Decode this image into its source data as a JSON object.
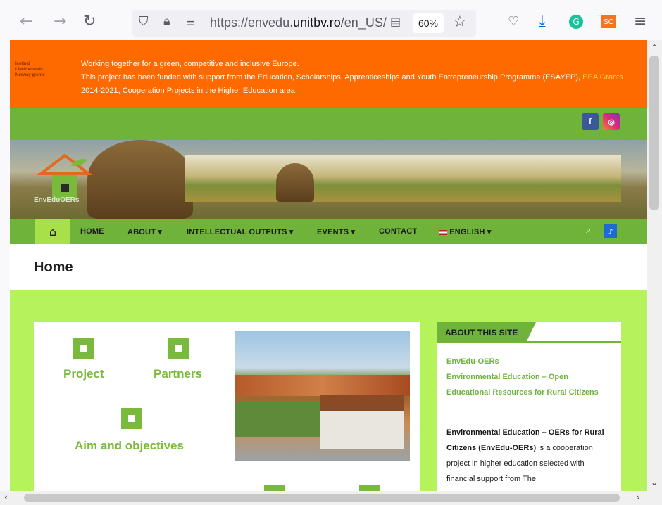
{
  "browser": {
    "url_prefix": "https://envedu.",
    "url_domain": "unitbv.ro",
    "url_suffix": "/en_US/",
    "zoom": "60%",
    "ext_label": "SC"
  },
  "funding": {
    "logo_lines": [
      "Iceland",
      "Liechtenstein",
      "Norway grants"
    ],
    "line1": "Working together for a green, competitive and inclusive Europe.",
    "line2_a": "This project has been funded with support from the Education, Scholarships, Apprenticeships and Youth Entrepreneurship Programme (ESAYEP),",
    "line2_link": "EEA Grants",
    "line2_b": "2014-2021, Cooperation Projects in the Higher Education area."
  },
  "site_logo": "EnvEduOERs",
  "nav": {
    "items": [
      "HOME",
      "ABOUT",
      "INTELLECTUAL OUTPUTS",
      "EVENTS",
      "CONTACT",
      "ENGLISH"
    ]
  },
  "page": {
    "title": "Home"
  },
  "card": {
    "project": "Project",
    "partners": "Partners",
    "aim": "Aim and objectives"
  },
  "sidebar": {
    "heading": "ABOUT THIS SITE",
    "links": [
      "EnvEdu-OERs",
      "Environmental Education – Open Educational Resources for Rural Citizens"
    ],
    "body_bold": "Environmental Education – OERs for Rural Citizens (EnvEdu-OERs)",
    "body_text": "is a cooperation project in higher education selected with financial support from The"
  },
  "colors": {
    "orange": "#ff6a00",
    "green": "#6fb33b",
    "lime": "#b5f25c"
  }
}
